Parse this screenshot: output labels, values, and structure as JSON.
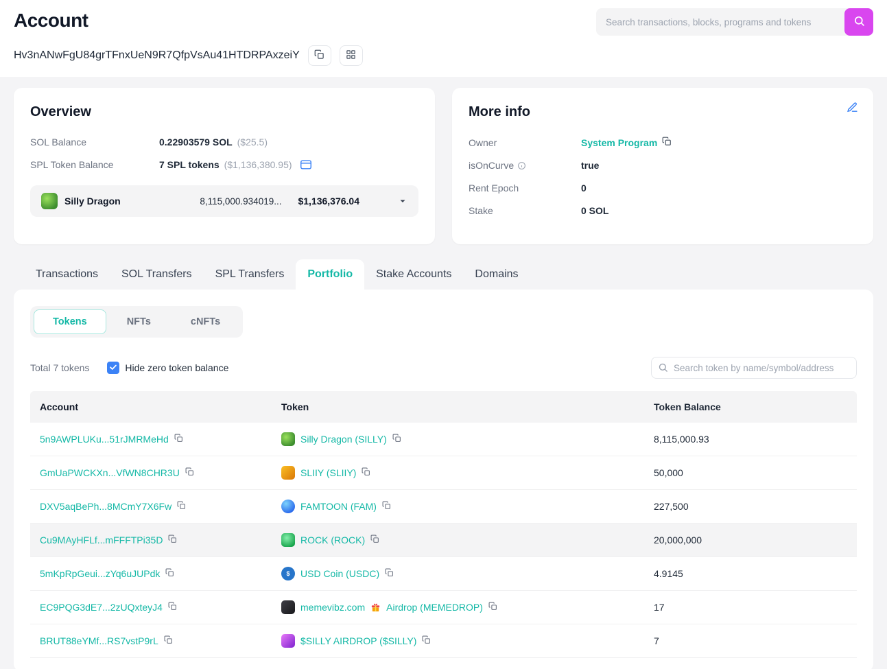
{
  "colors": {
    "accent_teal": "#14b8a6",
    "search_button_pink": "#d946ef",
    "checkbox_blue": "#3b82f6",
    "usdc_blue": "#2775ca"
  },
  "icons": {
    "search": "magnifier",
    "copy": "overlapping-squares",
    "grid": "four-squares",
    "wallet": "card-outline",
    "edit": "pen",
    "info": "circle-i",
    "chevron_down": "solid-triangle-down",
    "checkbox_check": "checkmark",
    "gift": "gift-box"
  },
  "header": {
    "title": "Account",
    "address": "Hv3nANwFgU84grTFnxUeN9R7QfpVsAu41HTDRPAxzeiY",
    "search_placeholder": "Search transactions, blocks, programs and tokens"
  },
  "overview": {
    "title": "Overview",
    "sol_balance_label": "SOL Balance",
    "sol_balance_value": "0.22903579 SOL",
    "sol_balance_usd": "($25.5)",
    "spl_label": "SPL Token Balance",
    "spl_value": "7 SPL tokens",
    "spl_usd": "($1,136,380.95)",
    "token_selector": {
      "name": "Silly Dragon",
      "amount": "8,115,000.934019...",
      "usd": "$1,136,376.04"
    }
  },
  "more_info": {
    "title": "More info",
    "owner_label": "Owner",
    "owner_value": "System Program",
    "isoncurve_label": "isOnCurve",
    "isoncurve_value": "true",
    "rent_epoch_label": "Rent Epoch",
    "rent_epoch_value": "0",
    "stake_label": "Stake",
    "stake_value": "0 SOL"
  },
  "tabs": [
    {
      "label": "Transactions",
      "active": false
    },
    {
      "label": "SOL Transfers",
      "active": false
    },
    {
      "label": "SPL Transfers",
      "active": false
    },
    {
      "label": "Portfolio",
      "active": true
    },
    {
      "label": "Stake Accounts",
      "active": false
    },
    {
      "label": "Domains",
      "active": false
    }
  ],
  "portfolio": {
    "sub_tabs": [
      {
        "label": "Tokens",
        "active": true
      },
      {
        "label": "NFTs",
        "active": false
      },
      {
        "label": "cNFTs",
        "active": false
      }
    ],
    "total_text": "Total 7 tokens",
    "hide_zero_checked": true,
    "hide_zero_label": "Hide zero token balance",
    "token_search_placeholder": "Search token by name/symbol/address",
    "table": {
      "headers": [
        "Account",
        "Token",
        "Token Balance"
      ],
      "rows": [
        {
          "account": "5n9AWPLUKu...51rJMRMeHd",
          "token": "Silly Dragon (SILLY)",
          "balance": "8,115,000.93"
        },
        {
          "account": "GmUaPWCKXn...VfWN8CHR3U",
          "token": "SLIIY (SLIIY)",
          "balance": "50,000"
        },
        {
          "account": "DXV5aqBePh...8MCmY7X6Fw",
          "token": "FAMTOON (FAM)",
          "balance": "227,500"
        },
        {
          "account": "Cu9MAyHFLf...mFFFTPi35D",
          "token": "ROCK (ROCK)",
          "balance": "20,000,000"
        },
        {
          "account": "5mKpRpGeui...zYq6uJUPdk",
          "token": "USD Coin (USDC)",
          "balance": "4.9145"
        },
        {
          "account": "EC9PQG3dE7...2zUQxteyJ4",
          "token": "memevibz.com",
          "token_suffix": "Airdrop (MEMEDROP)",
          "balance": "17"
        },
        {
          "account": "BRUT88eYMf...RS7vstP9rL",
          "token": "$SILLY AIRDROP ($SILLY)",
          "balance": "7"
        }
      ]
    }
  }
}
